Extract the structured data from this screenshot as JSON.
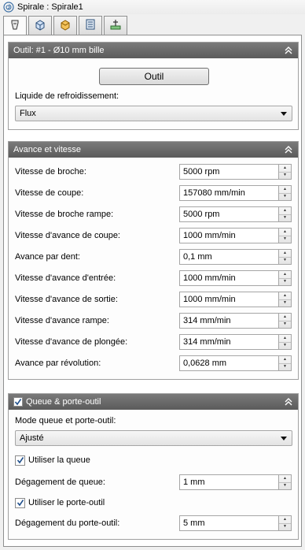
{
  "window": {
    "title": "Spirale : Spirale1",
    "app_icon": "spiral-icon"
  },
  "tabs": [
    {
      "icon": "tool-icon",
      "active": true
    },
    {
      "icon": "geometry-icon",
      "active": false
    },
    {
      "icon": "heights-icon",
      "active": false
    },
    {
      "icon": "passes-icon",
      "active": false
    },
    {
      "icon": "linking-icon",
      "active": false
    }
  ],
  "tool_group": {
    "header": "Outil: #1 - Ø10 mm bille",
    "button_label": "Outil",
    "coolant_label": "Liquide de refroidissement:",
    "coolant_value": "Flux"
  },
  "feeds_group": {
    "header": "Avance et vitesse",
    "rows": [
      {
        "label": "Vitesse de broche:",
        "value": "5000 rpm"
      },
      {
        "label": "Vitesse de coupe:",
        "value": "157080 mm/min"
      },
      {
        "label": "Vitesse de broche rampe:",
        "value": "5000 rpm"
      },
      {
        "label": "Vitesse d'avance de coupe:",
        "value": "1000 mm/min"
      },
      {
        "label": "Avance par dent:",
        "value": "0,1 mm"
      },
      {
        "label": "Vitesse d'avance d'entrée:",
        "value": "1000 mm/min"
      },
      {
        "label": "Vitesse d'avance de sortie:",
        "value": "1000 mm/min"
      },
      {
        "label": "Vitesse d'avance rampe:",
        "value": "314 mm/min"
      },
      {
        "label": "Vitesse d'avance de plongée:",
        "value": "314 mm/min"
      },
      {
        "label": "Avance par révolution:",
        "value": "0,0628 mm"
      }
    ]
  },
  "holder_group": {
    "header": "Queue & porte-outil",
    "header_checked": true,
    "mode_label": "Mode queue et porte-outil:",
    "mode_value": "Ajusté",
    "use_shaft_label": "Utiliser la queue",
    "use_shaft_checked": true,
    "shaft_clearance_label": "Dégagement de queue:",
    "shaft_clearance_value": "1 mm",
    "use_holder_label": "Utiliser le porte-outil",
    "use_holder_checked": true,
    "holder_clearance_label": "Dégagement du porte-outil:",
    "holder_clearance_value": "5 mm"
  }
}
